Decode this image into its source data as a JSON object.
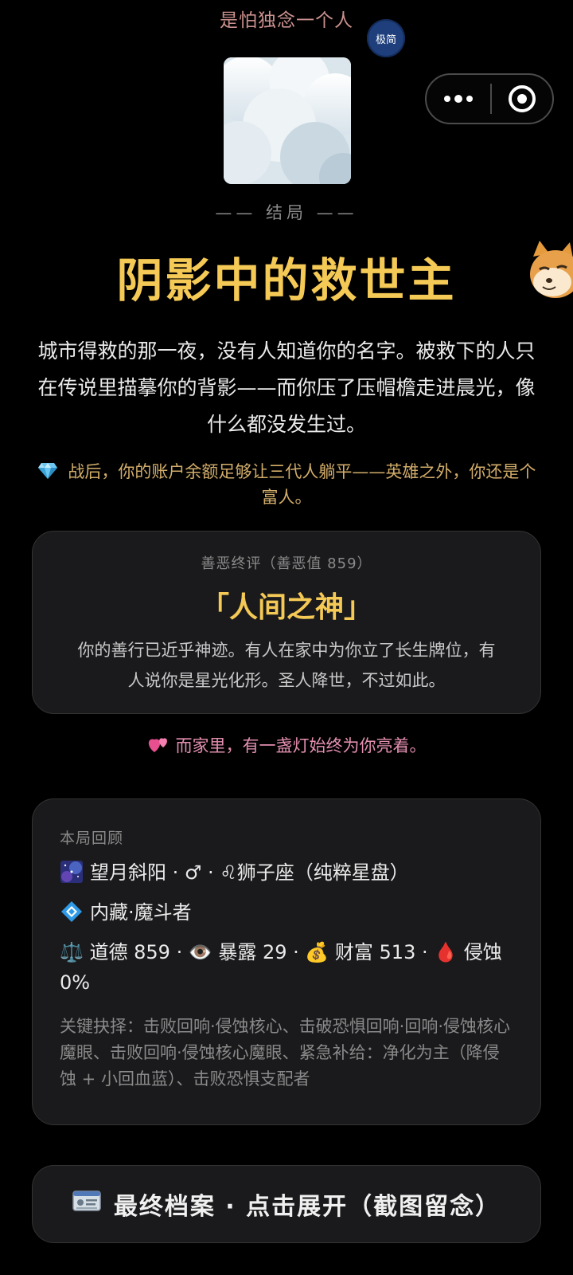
{
  "header": {
    "marquee": "是怕独念一个人",
    "mini_badge": "极简"
  },
  "ending": {
    "label": "—— 结局 ——",
    "title": "阴影中的救世主",
    "story": "城市得救的那一夜，没有人知道你的名字。被救下的人只在传说里描摹你的背影——而你压了压帽檐走进晨光，像什么都没发生过。",
    "wealth_icon": "diamond-icon",
    "wealth": "战后，你的账户余额足够让三代人躺平——英雄之外，你还是个富人。"
  },
  "verdict": {
    "subtitle": "善恶终评（善恶值 859）",
    "title": "「人间之神」",
    "description": "你的善行已近乎神迹。有人在家中为你立了长生牌位，有人说你是星光化形。圣人降世，不过如此。"
  },
  "family": {
    "icon": "two-hearts-icon",
    "text": "而家里，有一盏灯始终为你亮着。"
  },
  "recap": {
    "heading": "本局回顾",
    "identity_icon": "galaxy-icon",
    "identity": "望月斜阳 · ♂ · ♌狮子座（纯粹星盘）",
    "class_icon": "blue-diamond-icon",
    "class_text": "内藏·魔斗者",
    "stats": "⚖️ 道德 859 · 👁️ 暴露 29 · 💰 财富 513 · 🩸 侵蚀 0%",
    "key_choices": "关键抉择：击败回响·侵蚀核心、击破恐惧回响·回响·侵蚀核心魔眼、击败回响·侵蚀核心魔眼、紧急补给：净化为主（降侵蚀 + 小回血蓝）、击败恐惧支配者"
  },
  "archive": {
    "icon": "id-card-icon",
    "label": "最终档案 · 点击展开（截图留念）"
  }
}
